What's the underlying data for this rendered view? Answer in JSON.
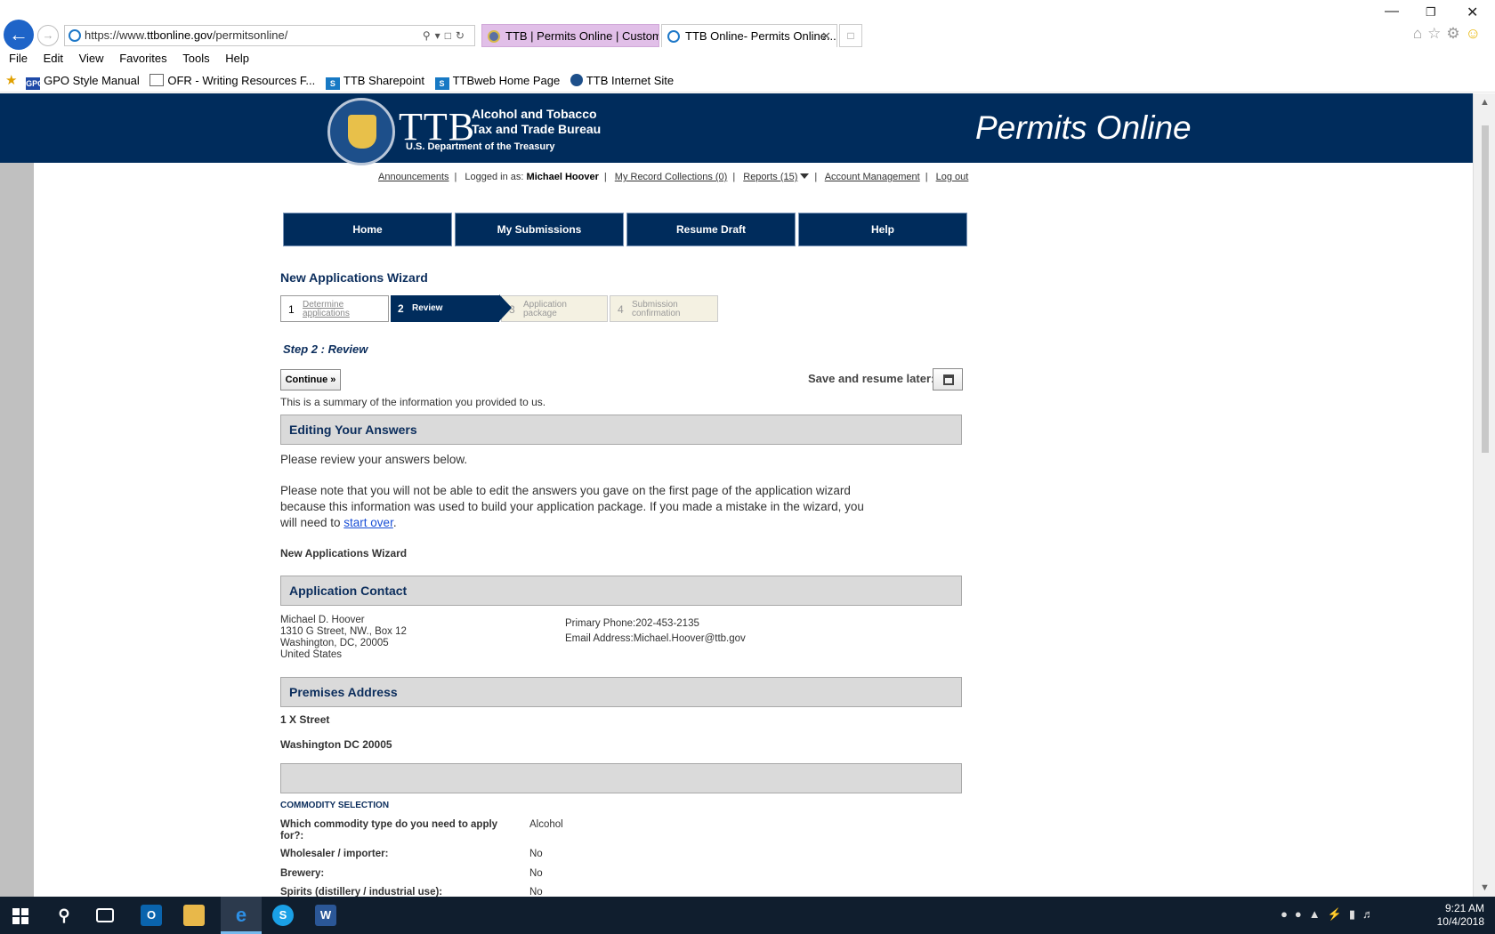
{
  "browser": {
    "url_prefix": "https://www.",
    "url_host": "ttbonline.gov",
    "url_path": "/permitsonline/",
    "tabs": [
      {
        "label": "TTB | Permits Online | Custom..."
      },
      {
        "label": "TTB Online- Permits Online..."
      }
    ],
    "menu": [
      "File",
      "Edit",
      "View",
      "Favorites",
      "Tools",
      "Help"
    ],
    "favorites": [
      {
        "label": "GPO Style Manual",
        "icon": "GPO"
      },
      {
        "label": "OFR - Writing Resources F..."
      },
      {
        "label": "TTB Sharepoint",
        "icon": "S"
      },
      {
        "label": "TTBweb Home Page",
        "icon": "S"
      },
      {
        "label": "TTB Internet Site"
      }
    ]
  },
  "banner": {
    "logo": "TTB",
    "bureau_line1": "Alcohol and Tobacco",
    "bureau_line2": "Tax and Trade Bureau",
    "dept": "U.S. Department of the Treasury",
    "app_title": "Permits Online"
  },
  "util": {
    "announcements": "Announcements",
    "logged_in_label": "Logged in as:",
    "user": "Michael Hoover",
    "record_collections": "My Record Collections (0)",
    "reports": "Reports (15)",
    "account": "Account Management",
    "logout": "Log out"
  },
  "nav": [
    "Home",
    "My Submissions",
    "Resume Draft",
    "Help"
  ],
  "wizard": {
    "title": "New Applications Wizard",
    "steps": [
      {
        "num": "1",
        "line1": "Determine",
        "line2": "applications"
      },
      {
        "num": "2",
        "line1": "Review",
        "line2": ""
      },
      {
        "num": "3",
        "line1": "Application",
        "line2": "package"
      },
      {
        "num": "4",
        "line1": "Submission",
        "line2": "confirmation"
      }
    ],
    "step_heading": "Step 2 : Review",
    "continue": "Continue »",
    "save_label": "Save and resume later:"
  },
  "content": {
    "summary": "This is a summary of the information you provided to us.",
    "editing_title": "Editing Your Answers",
    "review_text": "Please review your answers below.",
    "note_line1": "Please note that you will not be able to edit the answers you gave on the first page of the application wizard",
    "note_line2": "because this information was used to build your application package. If you made a mistake in the wizard, you",
    "note_line3_pre": "will need to ",
    "note_link": "start over",
    "note_line3_post": ".",
    "wizard_label": "New Applications Wizard",
    "contact_title": "Application Contact",
    "contact": {
      "name": "Michael D. Hoover",
      "street": "1310 G Street, NW., Box 12",
      "city": "Washington, DC, 20005",
      "country": "United States",
      "phone": "Primary Phone:202-453-2135",
      "email": "Email Address:Michael.Hoover@ttb.gov"
    },
    "premises_title": "Premises Address",
    "premises_line1": "1 X Street",
    "premises_line2": "Washington DC 20005",
    "commodity_head": "COMMODITY SELECTION",
    "questions": [
      {
        "q1": "Which commodity type do you need to apply",
        "q2": "for?:",
        "a": "Alcohol"
      },
      {
        "q1": "Wholesaler / importer:",
        "q2": "",
        "a": "No"
      },
      {
        "q1": "Brewery:",
        "q2": "",
        "a": "No"
      },
      {
        "q1": "Spirits (distillery / industrial use):",
        "q2": "",
        "a": "No"
      }
    ]
  },
  "taskbar": {
    "time": "9:21 AM",
    "date": "10/4/2018"
  }
}
